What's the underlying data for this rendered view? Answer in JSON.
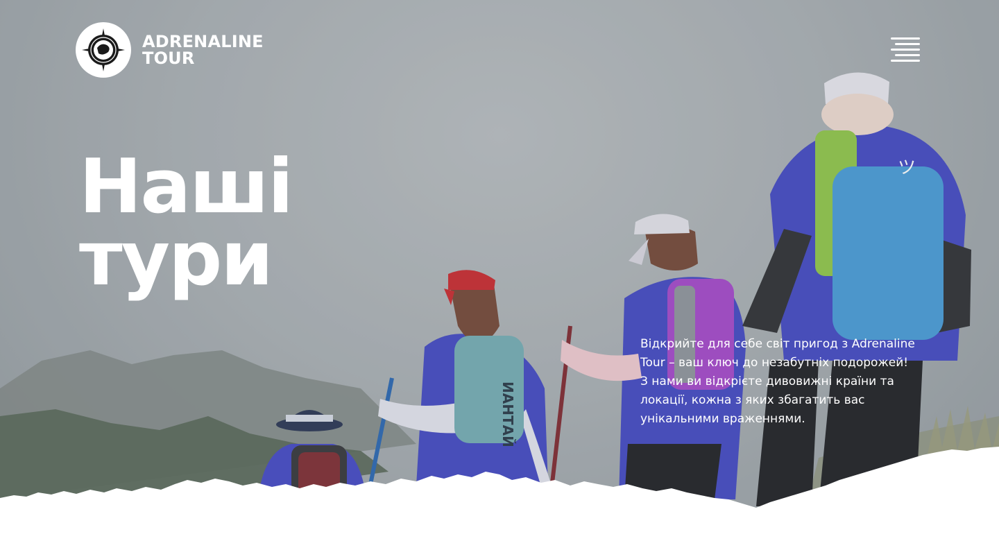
{
  "brand": {
    "name_line1": "ADRENALINE",
    "name_line2": "TOUR",
    "logo_icon": "globe-compass-icon"
  },
  "header": {
    "menu_icon": "hamburger-menu-icon"
  },
  "hero": {
    "title_line1": "Наші",
    "title_line2": "тури",
    "intro": "Відкрийте для себе світ пригод з Adrenaline Tour – ваш ключ до незабутніх подорожей! З нами ви відкрієте дивовижні країни та локації, кожна з яких збагатить вас унікальними враженнями.",
    "background": "hikers-on-misty-mountain-photo"
  },
  "colors": {
    "text": "#ffffff",
    "sky": "#a9aeb2",
    "mountains": "#5e6b5d",
    "shirt_blue": "#3a3fc0",
    "backpack_blue": "#3f97d6",
    "backpack_purple": "#a13ec7",
    "cap_red": "#c81e23"
  }
}
